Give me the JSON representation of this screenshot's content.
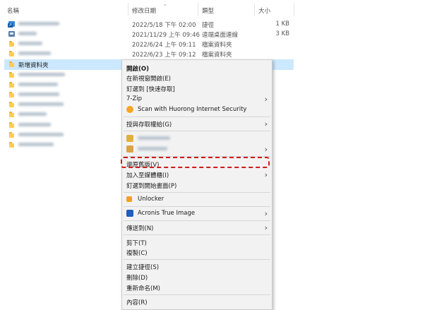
{
  "columns": {
    "name": "名稱",
    "date": "修改日期",
    "type": "類型",
    "size": "大小"
  },
  "files": [
    {
      "name": "",
      "date": "2022/5/18 下午 02:00",
      "type": "捷徑",
      "size": "1 KB",
      "icon": "shortcut-icon",
      "blurred": true
    },
    {
      "name": "",
      "date": "2021/11/29 上午 09:46",
      "type": "遠端桌面連線",
      "size": "3 KB",
      "icon": "remote-desktop-icon",
      "blurred": true
    },
    {
      "name": "",
      "date": "2022/6/24 上午 09:11",
      "type": "檔案資料夾",
      "size": "",
      "icon": "folder-icon",
      "blurred": true
    },
    {
      "name": "",
      "date": "2022/6/23 上午 09:12",
      "type": "檔案資料夾",
      "size": "",
      "icon": "folder-icon",
      "blurred": true
    },
    {
      "name": "新增資料夾",
      "date": "",
      "type": "",
      "size": "",
      "icon": "folder-icon",
      "selected": true
    },
    {
      "name": "",
      "icon": "folder-icon",
      "blurred": true
    },
    {
      "name": "",
      "icon": "folder-icon",
      "blurred": true
    },
    {
      "name": "",
      "icon": "folder-icon",
      "blurred": true
    },
    {
      "name": "",
      "icon": "folder-icon",
      "blurred": true
    },
    {
      "name": "",
      "icon": "folder-icon",
      "blurred": true
    },
    {
      "name": "",
      "icon": "folder-icon",
      "blurred": true
    },
    {
      "name": "",
      "icon": "folder-icon",
      "blurred": true
    },
    {
      "name": "",
      "icon": "folder-icon",
      "blurred": true
    }
  ],
  "menu": {
    "open": "開啟(O)",
    "open_new_window": "在新視窗開啟(E)",
    "pin_quick_access": "釘選到 [快速存取]",
    "seven_zip": "7-Zip",
    "huorong": "Scan with Huorong Internet Security",
    "grant_access": "授與存取權給(G)",
    "restore_versions": "還原舊版(V)",
    "include_library": "加入至媒體櫃(I)",
    "pin_start": "釘選到開始畫面(P)",
    "unlocker": "Unlocker",
    "acronis": "Acronis True Image",
    "send_to": "傳送到(N)",
    "cut": "剪下(T)",
    "copy": "複製(C)",
    "create_shortcut": "建立捷徑(S)",
    "delete": "刪除(D)",
    "rename": "重新命名(M)",
    "properties": "內容(R)"
  },
  "colors": {
    "selection": "#cce8ff",
    "highlight_box": "#d11a1a",
    "folder": "#ffce4a",
    "menu_bg": "#f2f2f2"
  }
}
